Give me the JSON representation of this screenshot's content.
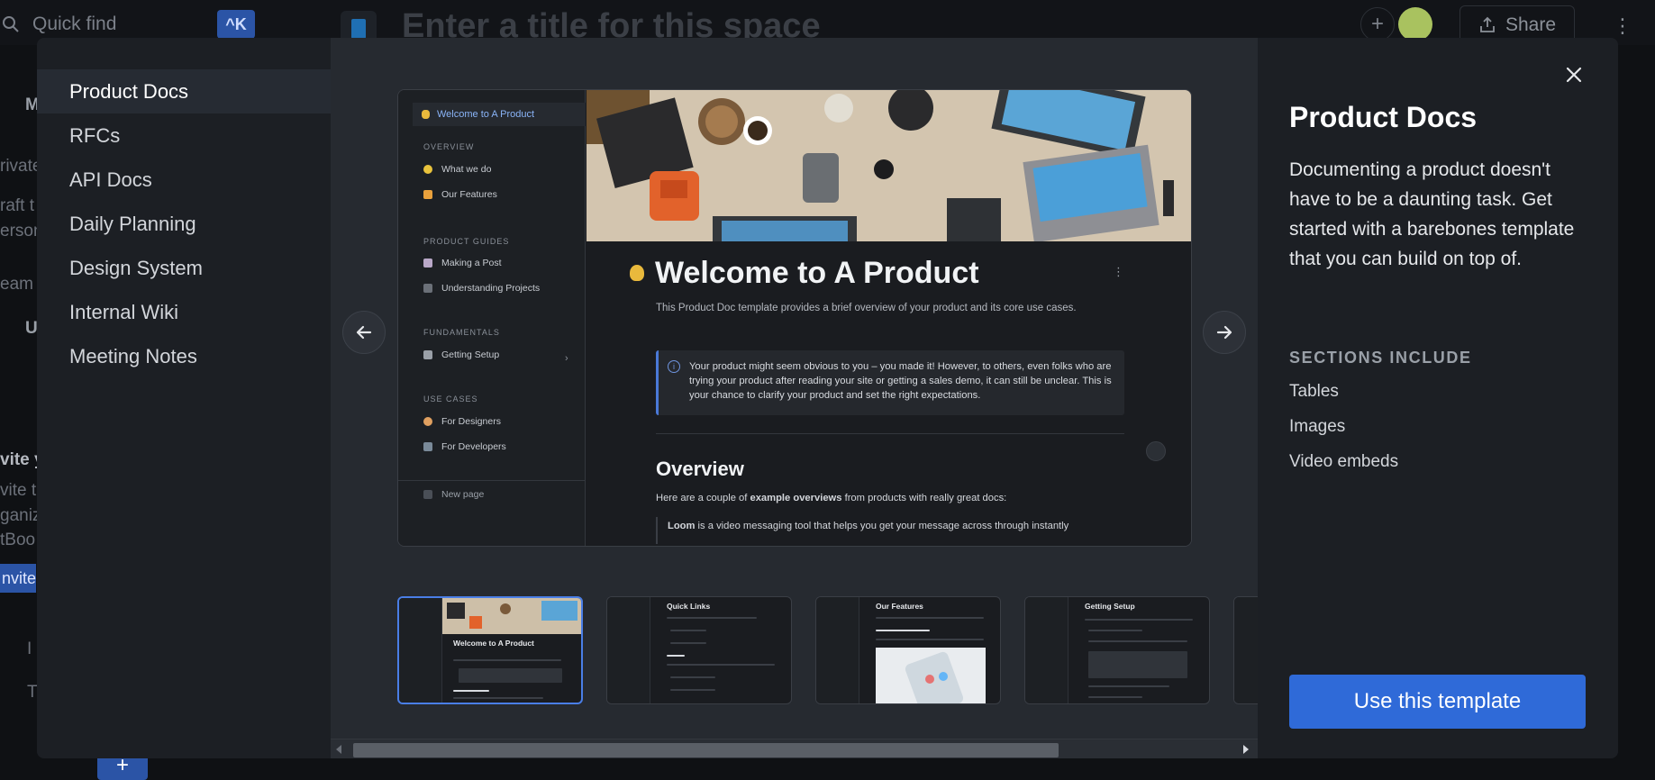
{
  "app": {
    "quick_find_label": "Quick find",
    "quick_find_shortcut": "^K",
    "space_title_placeholder": "Enter a title for this space",
    "share_label": "Share",
    "sidebar_fragments": [
      "M",
      "rivate",
      "raft t",
      "erson",
      "eam",
      "U",
      "vite y",
      "vite t",
      "ganiz",
      "tBoo",
      "I",
      "T"
    ],
    "invite_button_fragment": "nvite"
  },
  "templates": {
    "items": [
      {
        "label": "Product Docs",
        "active": true
      },
      {
        "label": "RFCs",
        "active": false
      },
      {
        "label": "API Docs",
        "active": false
      },
      {
        "label": "Daily Planning",
        "active": false
      },
      {
        "label": "Design System",
        "active": false
      },
      {
        "label": "Internal Wiki",
        "active": false
      },
      {
        "label": "Meeting Notes",
        "active": false
      }
    ]
  },
  "preview": {
    "sidebar": {
      "top_item": "Welcome to A Product",
      "sections": [
        {
          "title": "OVERVIEW",
          "items": [
            "What we do",
            "Our Features"
          ]
        },
        {
          "title": "PRODUCT GUIDES",
          "items": [
            "Making a Post",
            "Understanding Projects"
          ]
        },
        {
          "title": "FUNDAMENTALS",
          "items": [
            "Getting Setup"
          ]
        },
        {
          "title": "USE CASES",
          "items": [
            "For Designers",
            "For Developers"
          ]
        }
      ],
      "new_page": "New page"
    },
    "page_title": "Welcome to A Product",
    "subtitle": "This Product Doc template provides a brief overview of your product and its core use cases.",
    "callout": "Your product might seem obvious to you – you made it! However, to others, even folks who are trying your product after reading your site or getting a sales demo, it can still be unclear. This is your chance to clarify your product and set the right expectations.",
    "overview_heading": "Overview",
    "overview_text_before": "Here are a couple of ",
    "overview_text_bold": "example overviews",
    "overview_text_after": " from products with really great docs:",
    "loom_bold": "Loom",
    "loom_text": " is a video messaging tool that helps you get your message across through instantly"
  },
  "thumbnails": [
    {
      "title": "Welcome to A Product",
      "active": true
    },
    {
      "title": "Quick Links",
      "active": false
    },
    {
      "title": "Our Features",
      "active": false
    },
    {
      "title": "Getting Setup",
      "active": false
    }
  ],
  "details": {
    "title": "Product Docs",
    "description": "Documenting a product doesn't have to be a daunting task. Get started with a barebones template that you can build on top of.",
    "sections_heading": "SECTIONS INCLUDE",
    "sections": [
      "Tables",
      "Images",
      "Video embeds"
    ],
    "cta": "Use this template"
  },
  "colors": {
    "accent": "#2f6ad8",
    "modal_bg": "#1c1f24",
    "active_item_bg": "#262b33"
  }
}
